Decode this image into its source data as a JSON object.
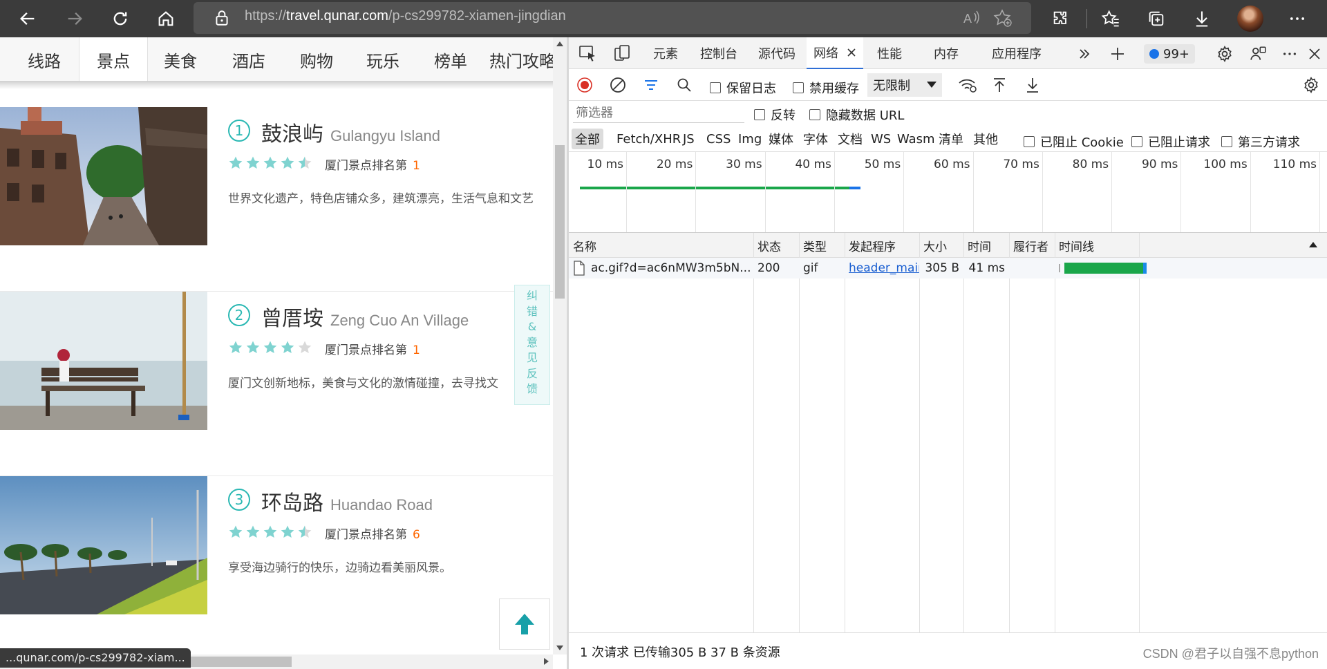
{
  "browser": {
    "url_prefix": "https://",
    "url_domain": "travel.qunar.com",
    "url_path": "/p-cs299782-xiamen-jingdian"
  },
  "page": {
    "tabs": [
      "线路",
      "景点",
      "美食",
      "酒店",
      "购物",
      "玩乐",
      "榜单",
      "热门攻略"
    ],
    "active_tab": "景点",
    "items": [
      {
        "rank": "1",
        "name": "鼓浪屿",
        "name_en": "Gulangyu Island",
        "rank_text": "厦门景点排名第",
        "rank_num": "1",
        "rating": 4.5,
        "desc": "世界文化遗产，特色店铺众多，建筑漂亮，生活气息和文艺"
      },
      {
        "rank": "2",
        "name": "曾厝垵",
        "name_en": "Zeng Cuo An Village",
        "rank_text": "厦门景点排名第",
        "rank_num": "1",
        "rating": 4.0,
        "desc": "厦门文创新地标，美食与文化的激情碰撞，去寻找文"
      },
      {
        "rank": "3",
        "name": "环岛路",
        "name_en": "Huandao Road",
        "rank_text": "厦门景点排名第",
        "rank_num": "6",
        "rating": 4.5,
        "desc": "享受海边骑行的快乐，边骑边看美丽风景。"
      }
    ],
    "feedback_chars": [
      "纠",
      "错",
      "&",
      "意",
      "见",
      "反",
      "馈"
    ],
    "status_url": "...qunar.com/p-cs299782-xiam..."
  },
  "devtools": {
    "tabs": [
      "元素",
      "控制台",
      "源代码",
      "网络",
      "性能",
      "内存",
      "应用程序"
    ],
    "active_tab": "网络",
    "issues_count": "99+",
    "toolbar": {
      "preserve_log": "保留日志",
      "disable_cache": "禁用缓存",
      "throttle": "无限制"
    },
    "filter": {
      "placeholder": "筛选器",
      "invert": "反转",
      "hide_data_urls": "隐藏数据 URL"
    },
    "types": [
      "全部",
      "Fetch/XHR",
      "JS",
      "CSS",
      "Img",
      "媒体",
      "字体",
      "文档",
      "WS",
      "Wasm",
      "清单",
      "其他"
    ],
    "type_checks": [
      "已阻止 Cookie",
      "已阻止请求",
      "第三方请求"
    ],
    "ticks": [
      "10 ms",
      "20 ms",
      "30 ms",
      "40 ms",
      "50 ms",
      "60 ms",
      "70 ms",
      "80 ms",
      "90 ms",
      "100 ms",
      "110 ms"
    ],
    "columns": [
      "名称",
      "状态",
      "类型",
      "发起程序",
      "大小",
      "时间",
      "履行者",
      "时间线"
    ],
    "rows": [
      {
        "name": "ac.gif?d=ac6nMW3m5bN...",
        "status": "200",
        "type": "gif",
        "initiator": "header_main...",
        "size": "305 B",
        "time": "41 ms",
        "fulfilled": ""
      }
    ],
    "status": "1 次请求  已传输305 B  37 B 条资源",
    "watermark": "CSDN @君子以自强不息python"
  }
}
